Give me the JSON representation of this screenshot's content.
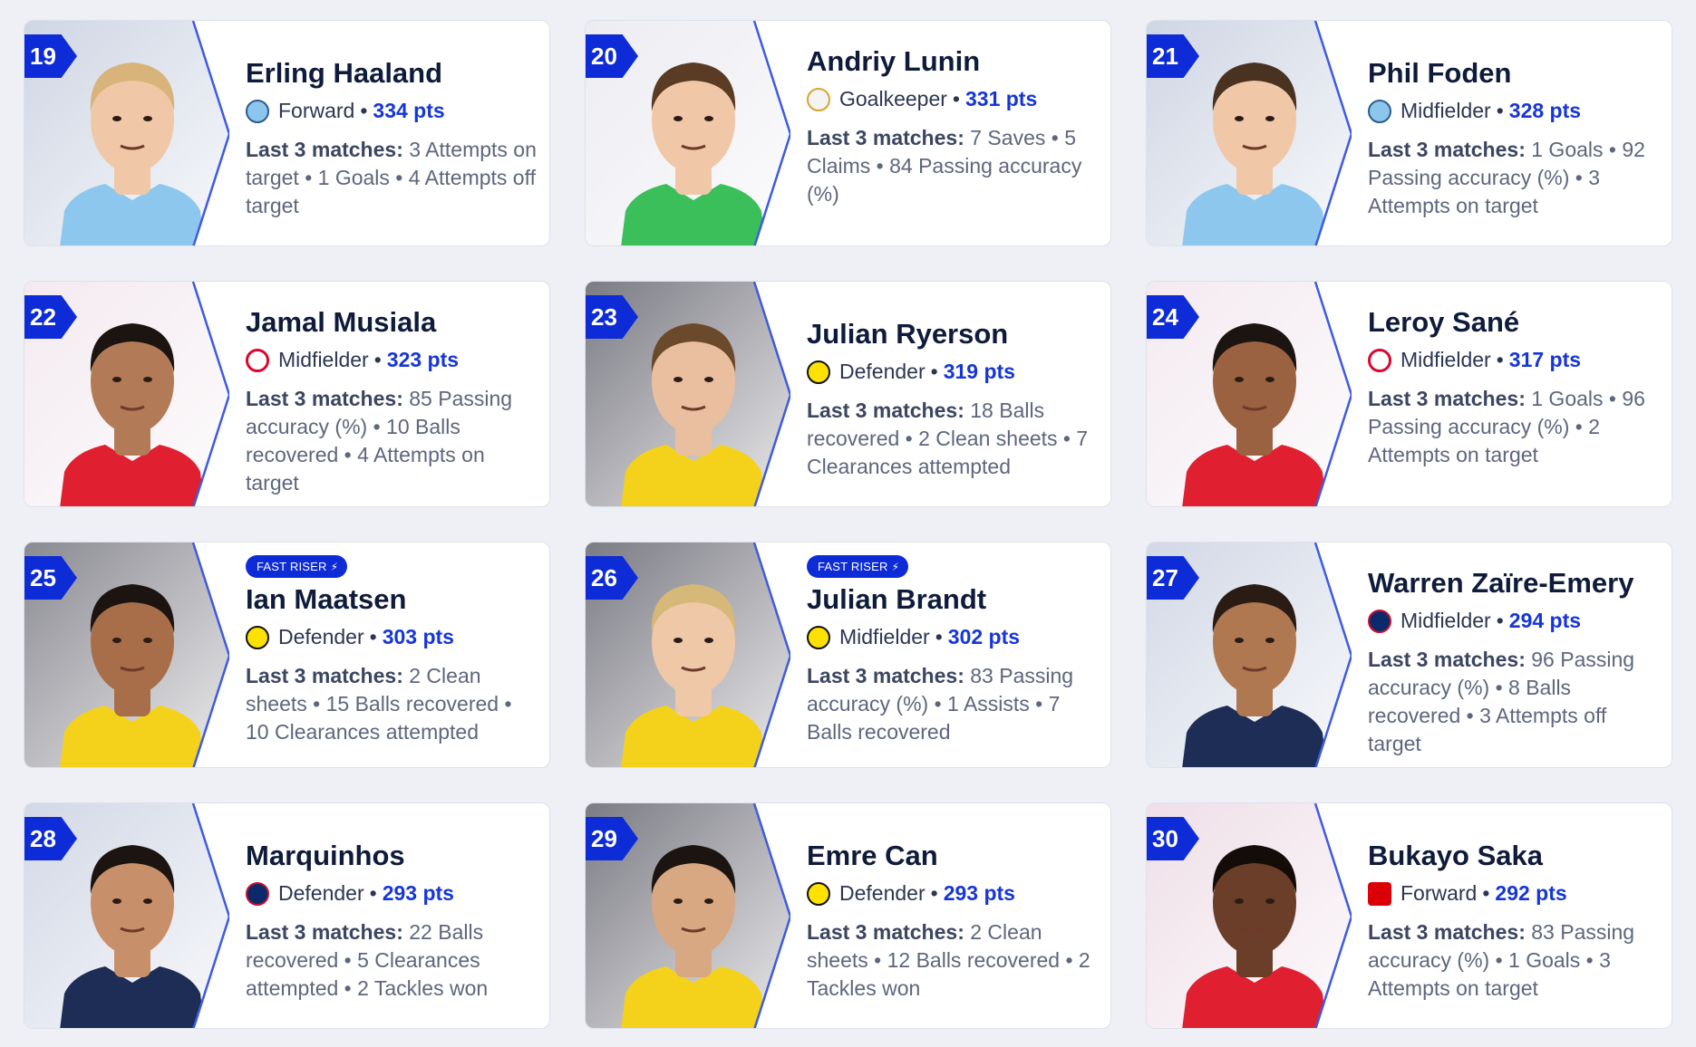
{
  "stats_label": "Last 3 matches:",
  "pts_suffix": "pts",
  "fast_riser_label": "FAST RISER",
  "players": [
    {
      "rank": "19",
      "name": "Erling Haaland",
      "position": "Forward",
      "points": "334",
      "club": "man-city-crest-icon",
      "club_class": "mci",
      "fast_riser": false,
      "stats": "3 Attempts on target • 1 Goals • 4 Attempts off target",
      "shirt": "#8ec7ee",
      "bg": "#cfd6e4",
      "skin": "#f0c8a8",
      "hair": "#d8b37a"
    },
    {
      "rank": "20",
      "name": "Andriy Lunin",
      "position": "Goalkeeper",
      "points": "331",
      "club": "real-madrid-crest-icon",
      "club_class": "rma",
      "fast_riser": false,
      "stats": "7 Saves • 5 Claims • 84 Passing accuracy (%)",
      "shirt": "#3bbf5a",
      "bg": "#ececf2",
      "skin": "#f0c8a8",
      "hair": "#5a3b24"
    },
    {
      "rank": "21",
      "name": "Phil Foden",
      "position": "Midfielder",
      "points": "328",
      "club": "man-city-crest-icon",
      "club_class": "mci",
      "fast_riser": false,
      "stats": "1 Goals • 92 Passing accuracy (%) • 3 Attempts on target",
      "shirt": "#8ec7ee",
      "bg": "#cfd6e4",
      "skin": "#f0c8a8",
      "hair": "#4a3220"
    },
    {
      "rank": "22",
      "name": "Jamal Musiala",
      "position": "Midfielder",
      "points": "323",
      "club": "bayern-crest-icon",
      "club_class": "bay",
      "fast_riser": false,
      "stats": "85 Passing accuracy (%) • 10 Balls recovered • 4 Attempts on target",
      "shirt": "#e02030",
      "bg": "#f3eaf0",
      "skin": "#b27a56",
      "hair": "#1c1410"
    },
    {
      "rank": "23",
      "name": "Julian Ryerson",
      "position": "Defender",
      "points": "319",
      "club": "dortmund-crest-icon",
      "club_class": "bvb",
      "fast_riser": false,
      "stats": "18 Balls recovered • 2 Clean sheets • 7 Clearances attempted",
      "shirt": "#f4d21c",
      "bg": "#7b7b84",
      "skin": "#e9bfa0",
      "hair": "#6b4a2c"
    },
    {
      "rank": "24",
      "name": "Leroy Sané",
      "position": "Midfielder",
      "points": "317",
      "club": "bayern-crest-icon",
      "club_class": "bay",
      "fast_riser": false,
      "stats": "1 Goals • 96 Passing accuracy (%) • 2 Attempts on target",
      "shirt": "#e02030",
      "bg": "#f3eaf0",
      "skin": "#9a6240",
      "hair": "#1c1410"
    },
    {
      "rank": "25",
      "name": "Ian Maatsen",
      "position": "Defender",
      "points": "303",
      "club": "dortmund-crest-icon",
      "club_class": "bvb",
      "fast_riser": true,
      "stats": "2 Clean sheets • 15 Balls recovered • 10 Clearances attempted",
      "shirt": "#f4d21c",
      "bg": "#8a8a92",
      "skin": "#a86e4a",
      "hair": "#1c1410"
    },
    {
      "rank": "26",
      "name": "Julian Brandt",
      "position": "Midfielder",
      "points": "302",
      "club": "dortmund-crest-icon",
      "club_class": "bvb",
      "fast_riser": true,
      "stats": "83 Passing accuracy (%) • 1 Assists • 7 Balls recovered",
      "shirt": "#f4d21c",
      "bg": "#7b7b84",
      "skin": "#efc8a8",
      "hair": "#d6b878"
    },
    {
      "rank": "27",
      "name": "Warren Zaïre-Emery",
      "position": "Midfielder",
      "points": "294",
      "club": "psg-crest-icon",
      "club_class": "psg",
      "fast_riser": false,
      "stats": "96 Passing accuracy (%) • 8 Balls recovered • 3 Attempts off target",
      "shirt": "#1d2d56",
      "bg": "#d2d8e6",
      "skin": "#b07850",
      "hair": "#2a1c14"
    },
    {
      "rank": "28",
      "name": "Marquinhos",
      "position": "Defender",
      "points": "293",
      "club": "psg-crest-icon",
      "club_class": "psg",
      "fast_riser": false,
      "stats": "22 Balls recovered • 5 Clearances attempted • 2 Tackles won",
      "shirt": "#1d2d56",
      "bg": "#d2d8e6",
      "skin": "#c8906a",
      "hair": "#1c1410"
    },
    {
      "rank": "29",
      "name": "Emre Can",
      "position": "Defender",
      "points": "293",
      "club": "dortmund-crest-icon",
      "club_class": "bvb",
      "fast_riser": false,
      "stats": "2 Clean sheets • 12 Balls recovered • 2 Tackles won",
      "shirt": "#f4d21c",
      "bg": "#7b7b84",
      "skin": "#d8a882",
      "hair": "#1c1410"
    },
    {
      "rank": "30",
      "name": "Bukayo Saka",
      "position": "Forward",
      "points": "292",
      "club": "arsenal-crest-icon",
      "club_class": "ars",
      "fast_riser": false,
      "stats": "83 Passing accuracy (%) • 1 Goals • 3 Attempts on target",
      "shirt": "#e02030",
      "bg": "#efdfe8",
      "skin": "#6a3e28",
      "hair": "#140c08"
    }
  ]
}
